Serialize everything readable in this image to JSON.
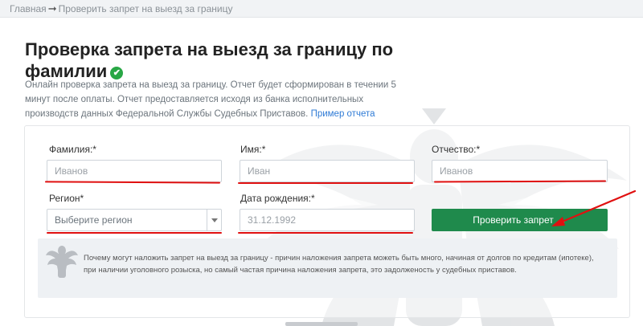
{
  "breadcrumb": {
    "home": "Главная",
    "separator": "➞",
    "current": "Проверить запрет на выезд за границу"
  },
  "page": {
    "title": "Проверка запрета на выезд за границу по фамилии",
    "badge_icon": "check-circle-icon",
    "description": "Онлайн проверка запрета на выезд за границу. Отчет будет сформирован в течении 5 минут после оплаты. Отчет предоставляется исходя из банка исполнительных производств данных Федеральной Службы Судебных Приставов.",
    "sample_link": "Пример отчета"
  },
  "form": {
    "surname": {
      "label": "Фамилия:*",
      "placeholder": "Иванов",
      "value": ""
    },
    "name": {
      "label": "Имя:*",
      "placeholder": "Иван",
      "value": ""
    },
    "patronymic": {
      "label": "Отчество:*",
      "placeholder": "Иванов",
      "value": ""
    },
    "region": {
      "label": "Регион*",
      "selected": "Выберите регион"
    },
    "birthdate": {
      "label": "Дата рождения:*",
      "placeholder": "31.12.1992",
      "value": ""
    },
    "submit_label": "Проверить запрет"
  },
  "info": {
    "text": "Почему могут наложить запрет на выезд за границу - причин наложения запрета можеть быть много, начиная от долгов по кредитам (ипотеке), при наличии уголовного розыска, но самый частая причина наложения запрета, это задолженость у судебных приставов.",
    "icon": "emblem-icon"
  },
  "colors": {
    "accent_green": "#1f8a4c",
    "badge_green": "#28a745",
    "annotation_red": "#e01010",
    "link_blue": "#2f7bd6"
  }
}
